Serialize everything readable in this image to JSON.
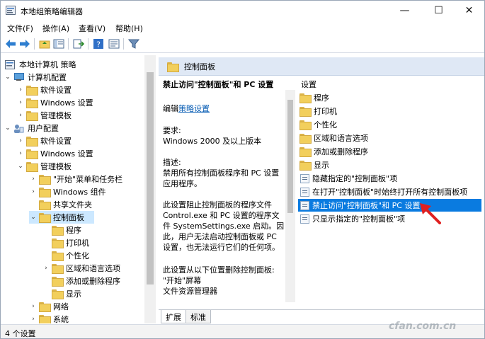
{
  "window": {
    "title": "本地组策略编辑器",
    "minimize_glyph": "—",
    "maximize_glyph": "☐",
    "close_glyph": "✕"
  },
  "menu": [
    "文件(F)",
    "操作(A)",
    "查看(V)",
    "帮助(H)"
  ],
  "toolbar": {
    "icons": [
      "back-arrow-icon",
      "forward-arrow-icon",
      "up-folder-icon",
      "show-hide-tree-icon",
      "export-list-icon",
      "help-icon",
      "properties-icon",
      "filter-icon"
    ]
  },
  "tree": {
    "root": "本地计算机 策略",
    "items": [
      "计算机配置",
      "软件设置",
      "Windows 设置",
      "管理模板",
      "用户配置",
      "软件设置",
      "Windows 设置",
      "管理模板",
      "\"开始\"菜单和任务栏",
      "Windows 组件",
      "共享文件夹",
      "控制面板",
      "程序",
      "打印机",
      "个性化",
      "区域和语言选项",
      "添加或删除程序",
      "显示",
      "网络",
      "系统"
    ]
  },
  "right_header": "控制面板",
  "description": {
    "title": "禁止访问\"控制面板\"和 PC 设置",
    "edit_prefix": "编辑",
    "edit_link": "策略设置",
    "requirement_label": "要求:",
    "requirement": "Windows 2000 及以上版本",
    "desc_label": "描述:",
    "desc_lines": [
      "禁用所有控制面板程序和 PC 设置",
      "应用程序。"
    ],
    "detail_lines": [
      "此设置阻止控制面板的程序文件",
      "Control.exe 和 PC 设置的程序文",
      "件 SystemSettings.exe 启动。因",
      "此，用户无法启动控制面板或 PC",
      "设置，也无法运行它们的任何项。"
    ],
    "extra_lines": [
      "此设置从以下位置删除控制面板:",
      "\"开始\"屏幕",
      "文件资源管理器"
    ]
  },
  "settings": {
    "header": "设置",
    "folders": [
      "程序",
      "打印机",
      "个性化",
      "区域和语言选项",
      "添加或删除程序",
      "显示"
    ],
    "policies": [
      "隐藏指定的\"控制面板\"项",
      "在打开\"控制面板\"时始终打开所有控制面板项",
      "禁止访问\"控制面板\"和 PC 设置",
      "只显示指定的\"控制面板\"项"
    ],
    "selected_index": 2
  },
  "tabs": [
    "扩展",
    "标准"
  ],
  "status": "4 个设置",
  "watermark": "cfan.com.cn",
  "colors": {
    "selection": "#0a7be0",
    "tree_selection": "#cce8ff",
    "header_bg": "#dfe8f5",
    "link": "#0b5fb5",
    "annotation": "#e02020"
  }
}
